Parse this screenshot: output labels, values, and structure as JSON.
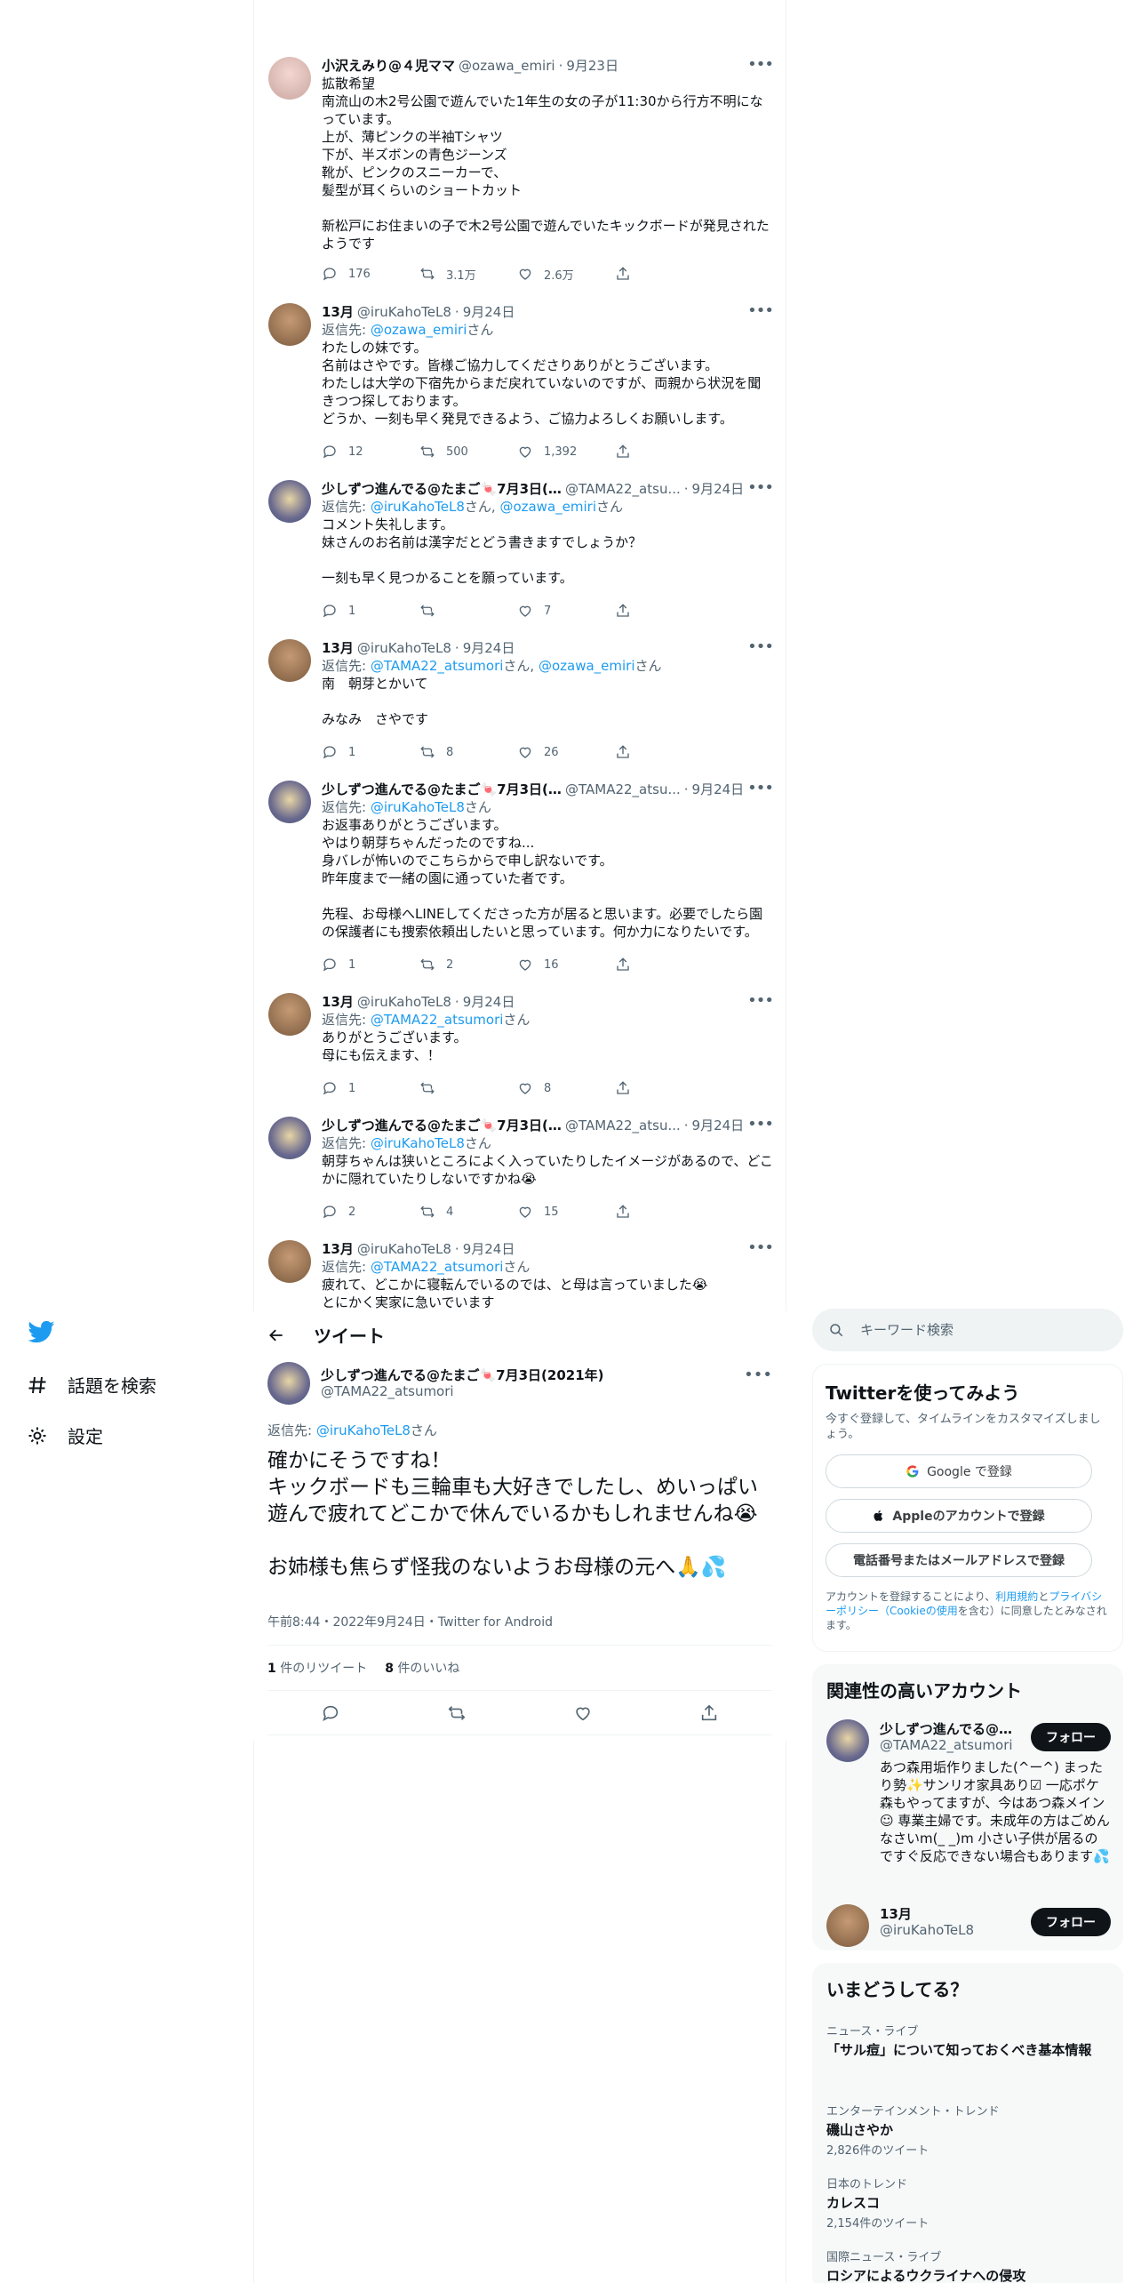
{
  "nav": {
    "explore_label": "話題を検索",
    "settings_label": "設定"
  },
  "thread": [
    {
      "name": "小沢えみり@４児ママ",
      "handle": "@ozawa_emiri",
      "date": "9月23日",
      "reply_prefix": "",
      "reply_mentions": [],
      "text": "拡散希望\n南流山の木2号公園で遊んでいた1年生の女の子が11:30から行方不明になっています。\n上が、薄ピンクの半袖Tシャツ\n下が、半ズボンの青色ジーンズ\n靴が、ピンクのスニーカーで、\n髪型が耳くらいのショートカット\n\n新松戸にお住まいの子で木2号公園で遊んでいたキックボードが発見されたようです",
      "replies": "176",
      "retweets": "3.1万",
      "likes": "2.6万"
    },
    {
      "name": "13月",
      "handle": "@iruKahoTeL8",
      "date": "9月24日",
      "reply_prefix": "返信先:",
      "reply_mentions": [
        "@ozawa_emiri"
      ],
      "text": "わたしの妹です。\n名前はさやです。皆様ご協力してくださりありがとうございます。\nわたしは大学の下宿先からまだ戻れていないのですが、両親から状況を聞きつつ探しております。\nどうか、一刻も早く発見できるよう、ご協力よろしくお願いします。",
      "replies": "12",
      "retweets": "500",
      "likes": "1,392"
    },
    {
      "name": "少しずつ進んでる@たまご🍬7月3日(2...",
      "handle": "@TAMA22_atsu...",
      "date": "9月24日",
      "reply_prefix": "返信先:",
      "reply_mentions": [
        "@iruKahoTeL8",
        "@ozawa_emiri"
      ],
      "text": "コメント失礼します。\n妹さんのお名前は漢字だとどう書きますでしょうか？\n\n一刻も早く見つかることを願っています。",
      "replies": "1",
      "retweets": "",
      "likes": "7"
    },
    {
      "name": "13月",
      "handle": "@iruKahoTeL8",
      "date": "9月24日",
      "reply_prefix": "返信先:",
      "reply_mentions": [
        "@TAMA22_atsumori",
        "@ozawa_emiri"
      ],
      "text": "南　朝芽とかいて\n\nみなみ　さやです",
      "replies": "1",
      "retweets": "8",
      "likes": "26"
    },
    {
      "name": "少しずつ進んでる@たまご🍬7月3日(2...",
      "handle": "@TAMA22_atsu...",
      "date": "9月24日",
      "reply_prefix": "返信先:",
      "reply_mentions": [
        "@iruKahoTeL8"
      ],
      "text": "お返事ありがとうございます。\nやはり朝芽ちゃんだったのですね...\n身バレが怖いのでこちらからで申し訳ないです。\n昨年度まで一緒の園に通っていた者です。\n\n先程、お母様へLINEしてくださった方が居ると思います。必要でしたら園の保護者にも捜索依頼出したいと思っています。何か力になりたいです。",
      "replies": "1",
      "retweets": "2",
      "likes": "16"
    },
    {
      "name": "13月",
      "handle": "@iruKahoTeL8",
      "date": "9月24日",
      "reply_prefix": "返信先:",
      "reply_mentions": [
        "@TAMA22_atsumori"
      ],
      "text": "ありがとうございます。\n母にも伝えます、！",
      "replies": "1",
      "retweets": "",
      "likes": "8"
    },
    {
      "name": "少しずつ進んでる@たまご🍬7月3日(2...",
      "handle": "@TAMA22_atsu...",
      "date": "9月24日",
      "reply_prefix": "返信先:",
      "reply_mentions": [
        "@iruKahoTeL8"
      ],
      "text": "朝芽ちゃんは狭いところによく入っていたりしたイメージがあるので、どこかに隠れていたりしないですかね😭",
      "replies": "2",
      "retweets": "4",
      "likes": "15"
    },
    {
      "name": "13月",
      "handle": "@iruKahoTeL8",
      "date": "9月24日",
      "reply_prefix": "返信先:",
      "reply_mentions": [
        "@TAMA22_atsumori"
      ],
      "text": "疲れて、どこかに寝転んでいるのでは、と母は言っていました😭\nとにかく実家に急いでいます",
      "replies": "",
      "retweets": "",
      "likes": ""
    }
  ],
  "focus_header": {
    "title": "ツイート"
  },
  "focus": {
    "name": "少しずつ進んでる@たまご🍬7月3日(2021年)",
    "handle": "@TAMA22_atsumori",
    "reply_prefix": "返信先:",
    "reply_mention": "@iruKahoTeL8",
    "reply_suffix": "さん",
    "text": "確かにそうですね！\nキックボードも三輪車も大好きでしたし、めいっぱい遊んで疲れてどこかで休んでいるかもしれませんね😭\n\nお姉様も焦らず怪我のないようお母様の元へ🙏💦",
    "meta": "午前8:44・2022年9月24日・Twitter for Android",
    "retweet_count": "1",
    "retweet_label": "件のリツイート",
    "like_count": "8",
    "like_label": "件のいいね"
  },
  "search": {
    "placeholder": "キーワード検索"
  },
  "signup": {
    "title": "Twitterを使ってみよう",
    "subtitle": "今すぐ登録して、タイムラインをカスタマイズしましょう。",
    "google_label": "Google で登録",
    "apple_label": "Appleのアカウントで登録",
    "phone_label": "電話番号またはメールアドレスで登録",
    "legal_prefix": "アカウントを登録することにより、",
    "legal_terms": "利用規約",
    "legal_and": "と",
    "legal_privacy": "プライバシーポリシー",
    "legal_cookie": "（Cookieの使用",
    "legal_suffix": "を含む）に同意したとみなされます。"
  },
  "relevant": {
    "title": "関連性の高いアカウント",
    "accounts": [
      {
        "name": "少しずつ進んでる@...",
        "handle": "@TAMA22_atsumori",
        "bio": "あつ森用垢作りました(^ー^) まったり勢✨サンリオ家具あり☑ 一応ポケ森もやってますが、今はあつ森メイン☺ 専業主婦です。未成年の方はごめんなさいm(_ _)m 小さい子供が居るのですぐ反応できない場合もあります💦",
        "follow_label": "フォロー"
      },
      {
        "name": "13月",
        "handle": "@iruKahoTeL8",
        "bio": "",
        "follow_label": "フォロー"
      }
    ]
  },
  "trends": {
    "title": "いまどうしてる？",
    "items": [
      {
        "category": "ニュース・ライブ",
        "title": "「サル痘」について知っておくべき基本情報",
        "count": ""
      },
      {
        "category": "エンターテインメント・トレンド",
        "title": "磯山さやか",
        "count": "2,826件のツイート"
      },
      {
        "category": "日本のトレンド",
        "title": "カレスコ",
        "count": "2,154件のツイート"
      },
      {
        "category": "国際ニュース・ライブ",
        "title": "ロシアによるウクライナへの侵攻",
        "count": ""
      }
    ]
  },
  "colors": {
    "accent": "#1d9bf0",
    "text": "#0f1419",
    "muted": "#536471",
    "border": "#eff3f4"
  }
}
